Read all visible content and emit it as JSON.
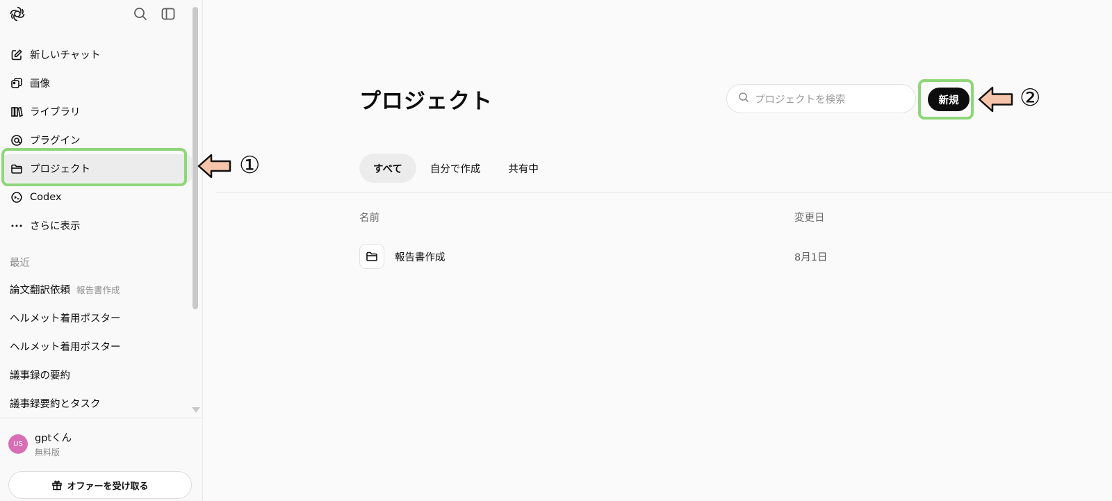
{
  "sidebar": {
    "nav": [
      {
        "label": "新しいチャット",
        "icon": "edit-icon"
      },
      {
        "label": "画像",
        "icon": "image-icon"
      },
      {
        "label": "ライブラリ",
        "icon": "library-icon"
      },
      {
        "label": "プラグイン",
        "icon": "plugin-icon"
      },
      {
        "label": "プロジェクト",
        "icon": "folder-icon",
        "active": true
      },
      {
        "label": "Codex",
        "icon": "codex-icon"
      },
      {
        "label": "さらに表示",
        "icon": "more-icon"
      }
    ],
    "recent_title": "最近",
    "recent": [
      {
        "label": "論文翻訳依頼",
        "tag": "報告書作成"
      },
      {
        "label": "ヘルメット着用ポスター"
      },
      {
        "label": "ヘルメット着用ポスター"
      },
      {
        "label": "議事録の要約"
      },
      {
        "label": "議事録要約とタスク"
      }
    ],
    "user": {
      "initials": "US",
      "name": "gptくん",
      "plan": "無料版"
    },
    "offer_label": "オファーを受け取る"
  },
  "main": {
    "title": "プロジェクト",
    "search_placeholder": "プロジェクトを検索",
    "new_label": "新規",
    "tabs": [
      {
        "label": "すべて",
        "active": true
      },
      {
        "label": "自分で作成"
      },
      {
        "label": "共有中"
      }
    ],
    "columns": {
      "name": "名前",
      "modified": "変更日"
    },
    "rows": [
      {
        "name": "報告書作成",
        "modified": "8月1日"
      }
    ]
  },
  "annotations": {
    "step1": "①",
    "step2": "②"
  },
  "colors": {
    "highlight": "#8fd67a",
    "arrow_fill": "#f6c4aa",
    "primary_button": "#0d0d0d"
  }
}
